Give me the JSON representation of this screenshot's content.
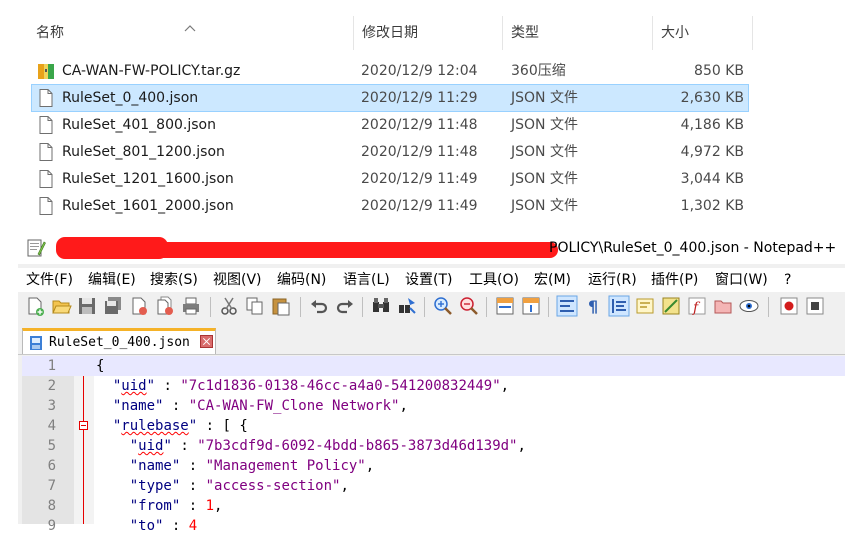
{
  "explorer": {
    "columns": {
      "name": "名称",
      "modified": "修改日期",
      "type": "类型",
      "size": "大小"
    },
    "files": [
      {
        "name": "CA-WAN-FW-POLICY.tar.gz",
        "modified": "2020/12/9 12:04",
        "type": "360压缩",
        "size": "850 KB",
        "icon": "archive-icon",
        "selected": false
      },
      {
        "name": "RuleSet_0_400.json",
        "modified": "2020/12/9 11:29",
        "type": "JSON 文件",
        "size": "2,630 KB",
        "icon": "file-icon",
        "selected": true
      },
      {
        "name": "RuleSet_401_800.json",
        "modified": "2020/12/9 11:48",
        "type": "JSON 文件",
        "size": "4,186 KB",
        "icon": "file-icon",
        "selected": false
      },
      {
        "name": "RuleSet_801_1200.json",
        "modified": "2020/12/9 11:48",
        "type": "JSON 文件",
        "size": "4,972 KB",
        "icon": "file-icon",
        "selected": false
      },
      {
        "name": "RuleSet_1201_1600.json",
        "modified": "2020/12/9 11:49",
        "type": "JSON 文件",
        "size": "3,044 KB",
        "icon": "file-icon",
        "selected": false
      },
      {
        "name": "RuleSet_1601_2000.json",
        "modified": "2020/12/9 11:49",
        "type": "JSON 文件",
        "size": "1,302 KB",
        "icon": "file-icon",
        "selected": false
      }
    ]
  },
  "notepad": {
    "title_visible": "POLICY\\RuleSet_0_400.json - Notepad++",
    "menu": [
      "文件(F)",
      "编辑(E)",
      "搜索(S)",
      "视图(V)",
      "编码(N)",
      "语言(L)",
      "设置(T)",
      "工具(O)",
      "宏(M)",
      "运行(R)",
      "插件(P)",
      "窗口(W)",
      "?"
    ],
    "tab_label": "RuleSet_0_400.json",
    "colors": {
      "redaction": "#ff1a1a",
      "selection": "#cce8ff",
      "tab_accent": "#f5b228"
    },
    "lines": [
      {
        "n": "1",
        "text": "{"
      },
      {
        "n": "2",
        "text": "  \"uid\" : \"7c1d1836-0138-46cc-a4a0-541200832449\","
      },
      {
        "n": "3",
        "text": "  \"name\" : \"CA-WAN-FW_Clone Network\","
      },
      {
        "n": "4",
        "text": "  \"rulebase\" : [ {"
      },
      {
        "n": "5",
        "text": "    \"uid\" : \"7b3cdf9d-6092-4bdd-b865-3873d46d139d\","
      },
      {
        "n": "6",
        "text": "    \"name\" : \"Management Policy\","
      },
      {
        "n": "7",
        "text": "    \"type\" : \"access-section\","
      },
      {
        "n": "8",
        "text": "    \"from\" : 1,"
      },
      {
        "n": "9",
        "text": "    \"to\" : 4"
      }
    ]
  }
}
